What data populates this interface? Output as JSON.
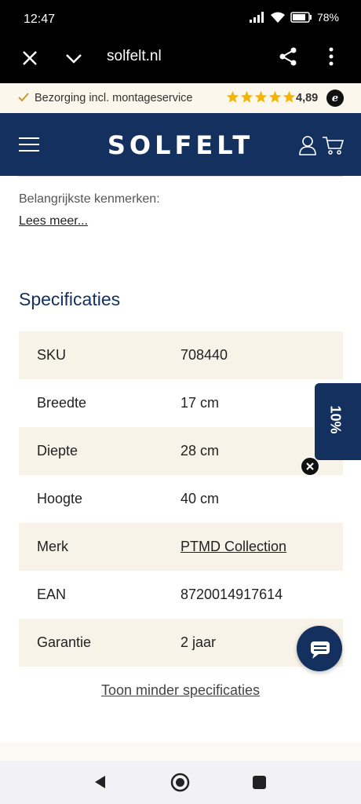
{
  "status": {
    "time": "12:47",
    "battery": "78%"
  },
  "browser": {
    "url": "solfelt.nl"
  },
  "promo": {
    "text": "Bezorging incl. montageservice",
    "rating": "4,89",
    "stars": 5,
    "seal": "e"
  },
  "header": {
    "logo": "SOLFELT"
  },
  "content": {
    "kenmerken": "Belangrijkste kenmerken:",
    "lees_meer": "Lees meer...",
    "spec_title": "Specificaties",
    "specs": [
      {
        "label": "SKU",
        "value": "708440"
      },
      {
        "label": "Breedte",
        "value": "17 cm"
      },
      {
        "label": "Diepte",
        "value": "28 cm"
      },
      {
        "label": "Hoogte",
        "value": "40 cm"
      },
      {
        "label": "Merk",
        "value": "PTMD Collection"
      },
      {
        "label": "EAN",
        "value": "8720014917614"
      },
      {
        "label": "Garantie",
        "value": "2 jaar"
      }
    ],
    "toon_minder": "Toon minder specificaties"
  },
  "widgets": {
    "discount": "10%"
  },
  "colors": {
    "navy": "#14305e",
    "cream": "#f8f3e8",
    "star": "#f5b400"
  }
}
